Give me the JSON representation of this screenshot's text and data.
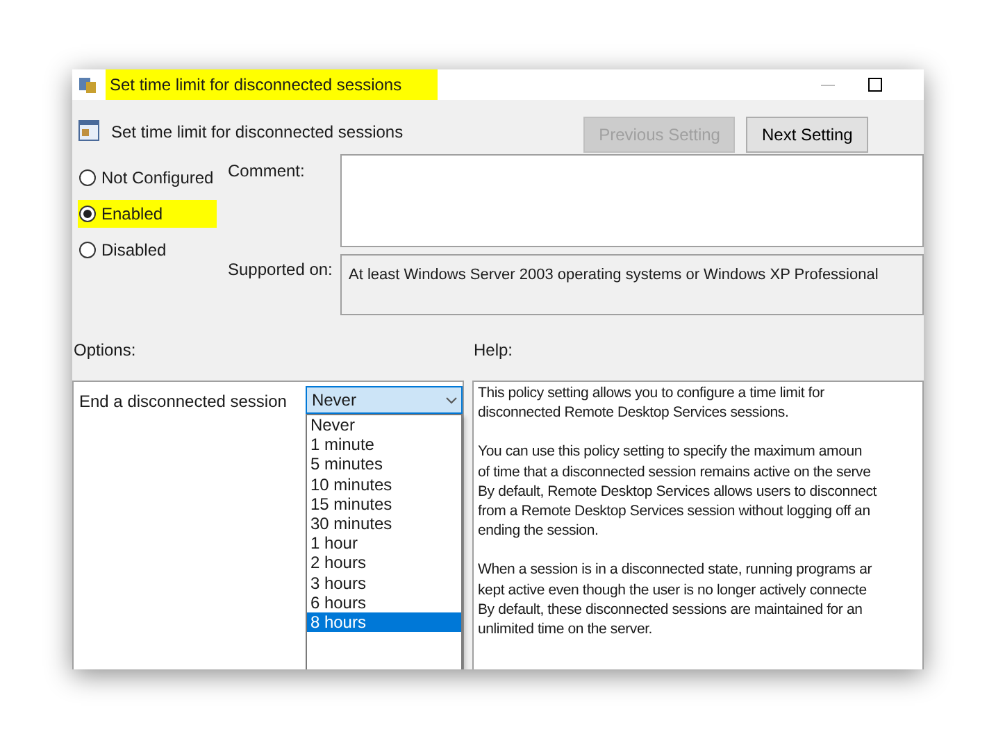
{
  "window": {
    "title": "Set time limit for disconnected sessions",
    "title_highlighted": true
  },
  "header": {
    "title": "Set time limit for disconnected sessions",
    "buttons": [
      {
        "label": "Previous Setting",
        "disabled": true
      },
      {
        "label": "Next Setting",
        "disabled": false
      }
    ]
  },
  "state_options": [
    {
      "label": "Not Configured",
      "selected": false,
      "highlighted": false
    },
    {
      "label": "Enabled",
      "selected": true,
      "highlighted": true
    },
    {
      "label": "Disabled",
      "selected": false,
      "highlighted": false
    }
  ],
  "comment": {
    "label": "Comment:"
  },
  "supported_on": {
    "label": "Supported on:",
    "value": "At least Windows Server 2003 operating systems or Windows XP Professional"
  },
  "options": {
    "label": "Options:",
    "setting_label": "End a disconnected session",
    "dropdown": {
      "value": "Never",
      "expanded": true,
      "items": [
        {
          "label": "Never",
          "highlighted": false
        },
        {
          "label": "1 minute",
          "highlighted": false
        },
        {
          "label": "5 minutes",
          "highlighted": false
        },
        {
          "label": "10 minutes",
          "highlighted": false
        },
        {
          "label": "15 minutes",
          "highlighted": false
        },
        {
          "label": "30 minutes",
          "highlighted": false
        },
        {
          "label": "1 hour",
          "highlighted": false
        },
        {
          "label": "2 hours",
          "highlighted": false
        },
        {
          "label": "3 hours",
          "highlighted": false
        },
        {
          "label": "6 hours",
          "highlighted": false
        },
        {
          "label": "8 hours",
          "highlighted": true
        }
      ]
    }
  },
  "help": {
    "label": "Help:",
    "paragraphs": [
      [
        "This policy setting allows you to configure a time limit for",
        "disconnected Remote Desktop Services sessions."
      ],
      [
        "You can use this policy setting to specify the maximum amoun",
        "of time that a disconnected session remains active on the serve",
        "By default, Remote Desktop Services allows users to disconnect",
        "from a Remote Desktop Services session without logging off an",
        "ending the session."
      ],
      [
        "When a session is in a disconnected state, running programs ar",
        "kept active even though the user is no longer actively connecte",
        "By default, these disconnected sessions are maintained for an",
        "unlimited time on the server."
      ]
    ]
  }
}
